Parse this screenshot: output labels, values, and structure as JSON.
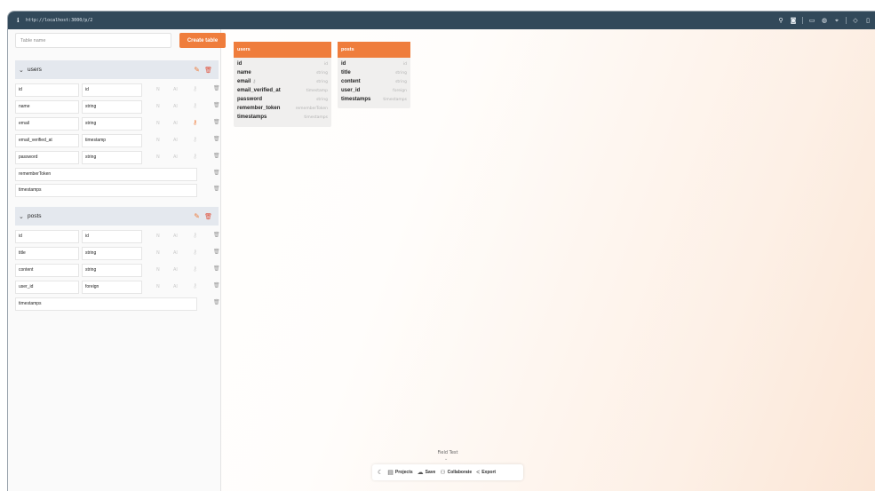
{
  "browser": {
    "url": "http://localhost:3000/p/2"
  },
  "sidebar": {
    "table_name_placeholder": "Table name",
    "create_button": "Create table",
    "tables": [
      {
        "name": "users",
        "fields": [
          {
            "name": "id",
            "type": "id"
          },
          {
            "name": "name",
            "type": "string"
          },
          {
            "name": "email",
            "type": "string",
            "key": true
          },
          {
            "name": "email_verified_at",
            "type": "timestamp"
          },
          {
            "name": "password",
            "type": "string"
          },
          {
            "name": "rememberToken"
          },
          {
            "name": "timestamps"
          }
        ]
      },
      {
        "name": "posts",
        "fields": [
          {
            "name": "id",
            "type": "id"
          },
          {
            "name": "title",
            "type": "string"
          },
          {
            "name": "content",
            "type": "string"
          },
          {
            "name": "user_id",
            "type": "foreign"
          },
          {
            "name": "timestamps"
          }
        ]
      }
    ],
    "flag_n": "N",
    "flag_ai": "AI"
  },
  "diagram": {
    "cards": [
      {
        "name": "users",
        "rows": [
          {
            "field": "id",
            "type": "id"
          },
          {
            "field": "name",
            "type": "string"
          },
          {
            "field": "email",
            "type": "string",
            "key": true
          },
          {
            "field": "email_verified_at",
            "type": "timestamp"
          },
          {
            "field": "password",
            "type": "string"
          },
          {
            "field": "remember_token",
            "type": "rememberToken"
          },
          {
            "field": "timestamps",
            "type": "timestamps"
          }
        ]
      },
      {
        "name": "posts",
        "rows": [
          {
            "field": "id",
            "type": "id"
          },
          {
            "field": "title",
            "type": "string"
          },
          {
            "field": "content",
            "type": "string"
          },
          {
            "field": "user_id",
            "type": "foreign"
          },
          {
            "field": "timestamps",
            "type": "timestamps"
          }
        ]
      }
    ]
  },
  "footer": {
    "project_title": "Field Test",
    "buttons": [
      "Projects",
      "Save",
      "Collaborate",
      "Export"
    ]
  },
  "colors": {
    "accent": "#ef7d3c",
    "danger": "#e0533d",
    "titlebar": "#32495a"
  }
}
